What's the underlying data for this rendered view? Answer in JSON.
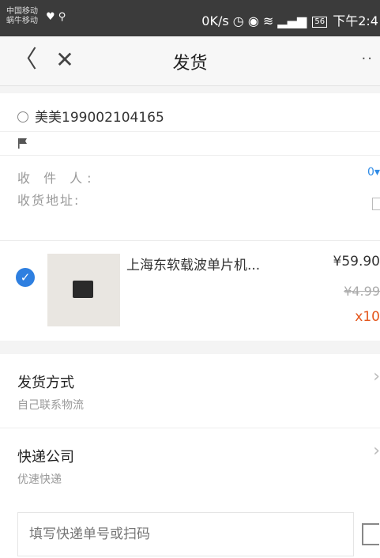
{
  "status_bar": {
    "carrier_line1": "中国移动",
    "carrier_line2": "蜗牛移动",
    "speed": "0K/s",
    "battery": "56",
    "time": "下午2:4"
  },
  "nav": {
    "back_icon": "chevron-left",
    "close_icon": "close",
    "title": "发货",
    "more": "··"
  },
  "buyer": {
    "name": "美美199002104165",
    "recipient_label": "收 件 人:",
    "address_label": "收货地址:",
    "recipient_value_fragment": "0"
  },
  "goods": {
    "checked": true,
    "title": "上海东软载波单片机...",
    "price": "¥59.90",
    "original_price": "¥4.99",
    "quantity": "x10"
  },
  "shipping": {
    "method_title": "发货方式",
    "method_value": "自己联系物流",
    "company_title": "快递公司",
    "company_value": "优速快递"
  },
  "tracking": {
    "placeholder": "填写快递单号或扫码"
  },
  "colors": {
    "accent": "#2e7fe0",
    "quantity": "#e4561c",
    "status_bar": "#3b3b3b"
  }
}
